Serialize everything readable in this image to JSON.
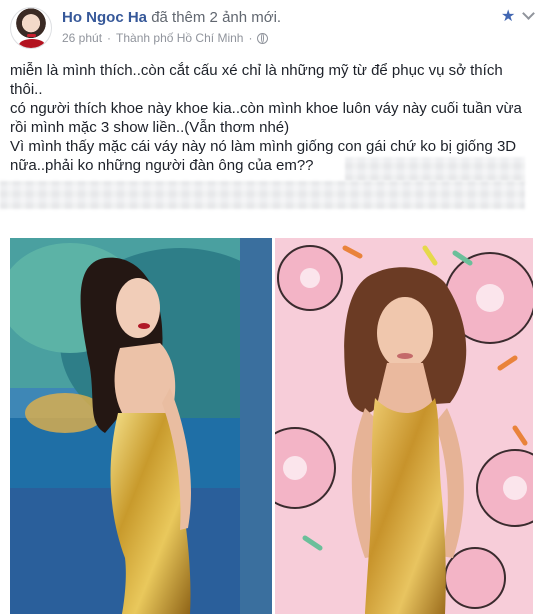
{
  "post": {
    "author": "Ho Ngoc Ha",
    "action": "đã thêm 2 ảnh mới.",
    "time": "26 phút",
    "separator": "·",
    "location": "Thành phố Hồ Chí Minh"
  },
  "text": {
    "line1": "miễn là mình thích..còn cắt cấu xé chỉ là những mỹ từ để phục vụ sở thích thôi..",
    "line2": "có người thích khoe này khoe kia..còn mình khoe luôn váy này cuối tuần vừa rồi mình mặc 3 show liền..(Vẫn thơm nhé)",
    "line3": "Vì mình thấy mặc cái váy này nó làm mình giống con gái chứ ko bị giống 3D nữa..phải ko những người đàn ông của em??"
  },
  "icons": {
    "star": "star-icon",
    "chevron": "chevron-down-icon",
    "globe": "globe-icon"
  },
  "colors": {
    "link": "#365899",
    "meta": "#90949c",
    "accent": "#4267b2",
    "dress": "#c89a2c"
  },
  "photos": [
    {
      "name": "photo-left",
      "description_bg": "blue-green painted wall"
    },
    {
      "name": "photo-right",
      "description_bg": "pink donut pattern wall"
    }
  ]
}
